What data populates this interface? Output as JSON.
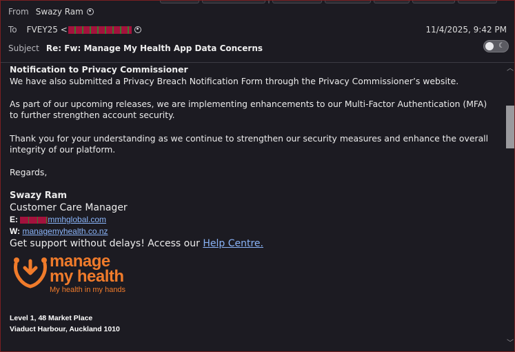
{
  "header": {
    "from_label": "From",
    "from_name": "Swazy Ram",
    "to_label": "To",
    "to_name": "FVEY25 <",
    "date": "11/4/2025, 9:42 PM",
    "subject_label": "Subject",
    "subject": "Re: Fw: Manage My Health App Data Concerns"
  },
  "body": {
    "heading": "Notification to Privacy Commissioner",
    "p1": "We have also submitted a Privacy Breach Notification Form through the Privacy Commissioner’s website.",
    "p2": "As part of our upcoming releases, we are implementing enhancements to our Multi-Factor Authentication (MFA) to further strengthen account security.",
    "p3": "Thank you for your understanding as we continue to strengthen our security measures and enhance the overall integrity of our platform.",
    "regards": "Regards,",
    "sig_name": "Swazy Ram",
    "sig_title": "Customer Care Manager",
    "email_label": "E:",
    "email_value": "mmhglobal.com",
    "web_label": "W:",
    "web_value": "managemyhealth.co.nz",
    "support_text": "Get support without delays! Access our ",
    "help_link": "Help Centre.",
    "logo_line1": "manage",
    "logo_line2": "my health",
    "logo_tagline": "My health in my hands",
    "addr1": "Level 1, 48 Market Place",
    "addr2": "Viaduct Harbour, Auckland 1010"
  },
  "colors": {
    "accent_orange": "#f07b2b",
    "link": "#8ab4f8",
    "redaction": "#a3123d"
  },
  "icons": [
    "person-icon",
    "theme-toggle",
    "moon-icon",
    "scroll-up-arrow",
    "scroll-down-arrow",
    "logo-mark-icon"
  ]
}
